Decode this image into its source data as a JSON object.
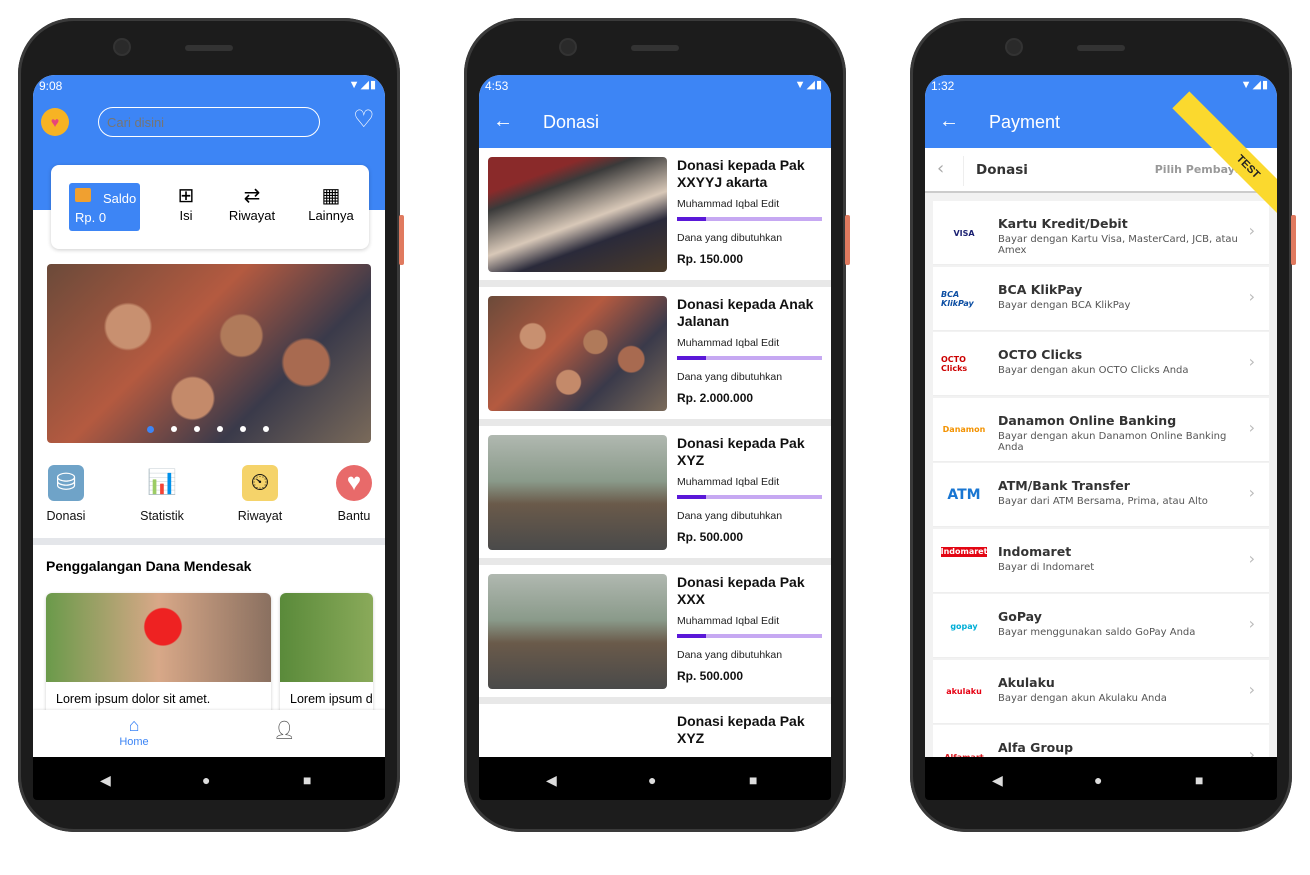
{
  "home": {
    "time": "9:08",
    "search_placeholder": "Cari disini",
    "saldo_label": "Saldo",
    "saldo_value": "Rp. 0",
    "actions": [
      "Isi",
      "Riwayat",
      "Lainnya"
    ],
    "categories": [
      "Donasi",
      "Statistik",
      "Riwayat",
      "Bantu"
    ],
    "section_title": "Penggalangan Dana Mendesak",
    "cards": [
      "Lorem ipsum dolor sit amet.",
      "Lorem ipsum d"
    ],
    "nav": {
      "home": "Home"
    },
    "accent": "#3d85f5"
  },
  "donasi": {
    "time": "4:53",
    "title": "Donasi",
    "items": [
      {
        "title": "Donasi kepada Pak XXYYJ akarta",
        "user": "Muhammad Iqbal Edit",
        "label": "Dana yang dibutuhkan",
        "amount": "Rp. 150.000",
        "progress": 0.2
      },
      {
        "title": "Donasi kepada Anak Jalanan",
        "user": "Muhammad Iqbal Edit",
        "label": "Dana yang dibutuhkan",
        "amount": "Rp. 2.000.000",
        "progress": 0.2
      },
      {
        "title": "Donasi kepada Pak XYZ",
        "user": "Muhammad Iqbal Edit",
        "label": "Dana yang dibutuhkan",
        "amount": "Rp. 500.000",
        "progress": 0.2
      },
      {
        "title": "Donasi kepada Pak XXX",
        "user": "Muhammad Iqbal Edit",
        "label": "Dana yang dibutuhkan",
        "amount": "Rp. 500.000",
        "progress": 0.2
      },
      {
        "title": "Donasi kepada Pak XYZ"
      }
    ]
  },
  "payment": {
    "time": "1:32",
    "title": "Payment",
    "sub_title": "Donasi",
    "sub_right": "Pilih Pembayaran",
    "ribbon": "TEST",
    "methods": [
      {
        "name": "Kartu Kredit/Debit",
        "desc": "Bayar dengan Kartu Visa, MasterCard, JCB, atau Amex",
        "logo": "VISA"
      },
      {
        "name": "BCA KlikPay",
        "desc": "Bayar dengan BCA KlikPay",
        "logo": "BCA KlikPay"
      },
      {
        "name": "OCTO Clicks",
        "desc": "Bayar dengan akun OCTO Clicks Anda",
        "logo": "OCTO Clicks"
      },
      {
        "name": "Danamon Online Banking",
        "desc": "Bayar dengan akun Danamon Online Banking Anda",
        "logo": "Danamon"
      },
      {
        "name": "ATM/Bank Transfer",
        "desc": "Bayar dari ATM Bersama, Prima, atau Alto",
        "logo": "ATM"
      },
      {
        "name": "Indomaret",
        "desc": "Bayar di Indomaret",
        "logo": "Indomaret"
      },
      {
        "name": "GoPay",
        "desc": "Bayar menggunakan saldo GoPay Anda",
        "logo": "gopay"
      },
      {
        "name": "Akulaku",
        "desc": "Bayar dengan akun Akulaku Anda",
        "logo": "akulaku"
      },
      {
        "name": "Alfa Group",
        "desc": "",
        "logo": "Alfamart"
      }
    ]
  }
}
